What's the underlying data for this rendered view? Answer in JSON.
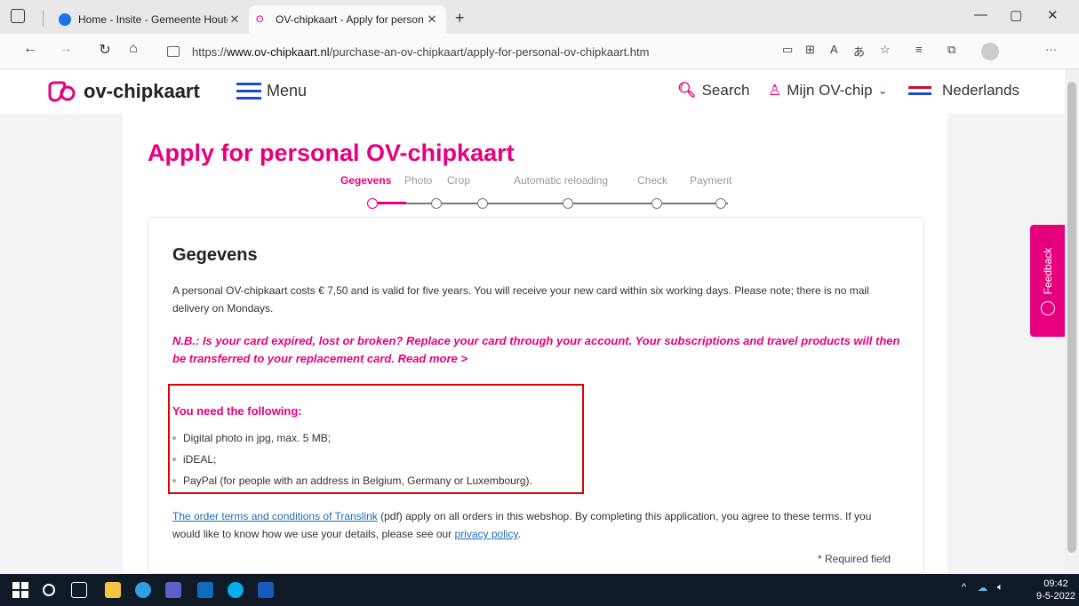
{
  "browser": {
    "tabs": [
      {
        "title": "Home - Insite - Gemeente Houte",
        "active": false
      },
      {
        "title": "OV-chipkaart - Apply for person",
        "active": true
      }
    ],
    "url_prefix": "https://",
    "url_host": "www.ov-chipkaart.nl",
    "url_path": "/purchase-an-ov-chipkaart/apply-for-personal-ov-chipkaart.htm"
  },
  "header": {
    "logo_text": "ov-chipkaart",
    "menu_label": "Menu",
    "search_label": "Search",
    "account_label": "Mijn OV-chip",
    "language_label": "Nederlands"
  },
  "page": {
    "title": "Apply for personal OV-chipkaart",
    "steps": [
      "Gegevens",
      "Photo",
      "Crop",
      "Automatic reloading",
      "Check",
      "Payment"
    ],
    "active_step": 0,
    "section_title": "Gegevens",
    "intro": "A personal OV-chipkaart costs € 7,50 and is valid for five years. You will receive your new card within six working days. Please note; there is no mail delivery on Mondays.",
    "nb_text": "N.B.: Is your card expired, lost or broken? Replace your card through your account. Your subscriptions and travel products will then be transferred to your replacement card. Read more >",
    "need_title": "You need the following:",
    "need_items": [
      "Digital photo in jpg, max. 5 MB;",
      "iDEAL;",
      "PayPal (for people with an address in Belgium, Germany or Luxembourg)."
    ],
    "terms_link": "The order terms and conditions of Translink",
    "terms_text": " (pdf) apply on all orders in this webshop. By completing this application, you agree to these terms. If you would like to know how we use your details, please see our ",
    "privacy_link": "privacy policy",
    "terms_end": ".",
    "required_note": "* Required field"
  },
  "feedback_label": "Feedback",
  "taskbar": {
    "time": "09:42",
    "date": "9-5-2022"
  },
  "colors": {
    "brand": "#e6007e",
    "menu_blue": "#1d49d0",
    "highlight_box": "#e00000"
  }
}
